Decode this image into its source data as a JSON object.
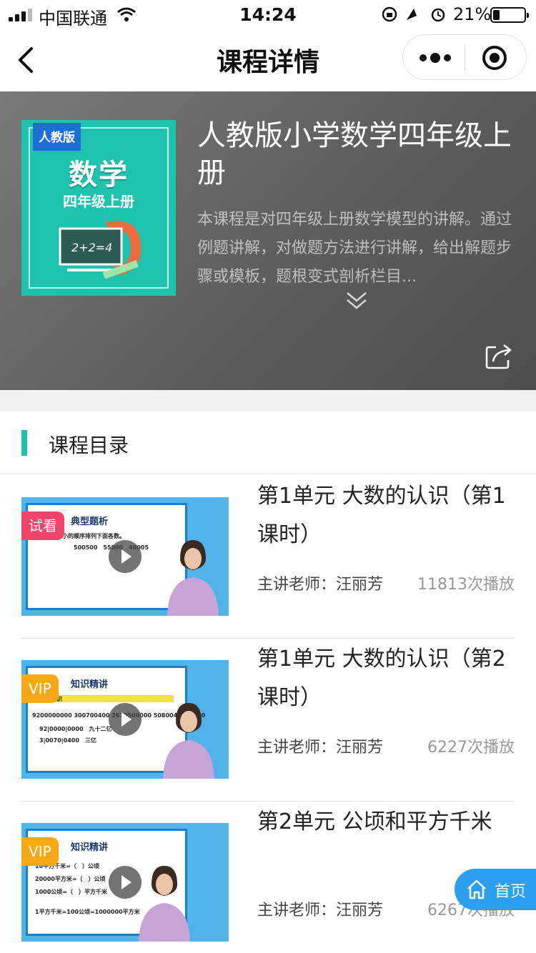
{
  "status_bar": {
    "carrier": "中国联通",
    "time": "14:24",
    "battery_percent": "21%",
    "battery_level": 0.21
  },
  "nav": {
    "title": "课程详情"
  },
  "course": {
    "cover": {
      "tag": "人教版",
      "subject": "数学",
      "grade": "四年级上册",
      "board_text": "2+2=4"
    },
    "title": "人教版小学数学四年级上册",
    "description": "本课程是对四年级上册数学模型的讲解。通过例题讲解，对做题方法进行讲解，给出解题步骤或模板，题根变式剖析栏目..."
  },
  "catalog": {
    "heading": "课程目录",
    "items": [
      {
        "badge": "试看",
        "badge_type": "trial",
        "thumb_title": "典型题析",
        "thumb_lines": [
          "从大到小的顺序排列下面各数。",
          "500500　55000　40005"
        ],
        "title": "第1单元 大数的认识（第1课时）",
        "teacher": "主讲老师：汪丽芳",
        "plays": "11813次播放"
      },
      {
        "badge": "VIP",
        "badge_type": "vip",
        "thumb_title": "知识精讲",
        "thumb_lines": [
          "的认识",
          "9200000000 300700400 2670500000 5080040003000",
          "92|0000|0000　九十二亿",
          "3|0070|0400　三亿"
        ],
        "title": "第1单元 大数的认识（第2课时）",
        "teacher": "主讲老师：汪丽芳",
        "plays": "6227次播放"
      },
      {
        "badge": "VIP",
        "badge_type": "vip",
        "thumb_title": "知识精讲",
        "thumb_lines": [
          "10平方千米=（　）公顷",
          "20000平方米=（　）公顷",
          "1000公顷=（　）平方千米",
          "1平方千米=100公顷=1000000平方米"
        ],
        "title": "第2单元 公顷和平方千米",
        "teacher": "主讲老师：汪丽芳",
        "plays": "6267次播放"
      }
    ]
  },
  "home_button": {
    "label": "首页"
  },
  "icons": [
    "back-icon",
    "more-icon",
    "target-icon",
    "expand-icon",
    "share-icon",
    "play-icon",
    "home-icon",
    "wifi-icon",
    "signal-icon",
    "battery-icon"
  ],
  "colors": {
    "accent": "#1ec3b0",
    "trial_badge": "#f0436a",
    "vip_badge": "#f5a714",
    "home_button": "#2c9ff0"
  }
}
